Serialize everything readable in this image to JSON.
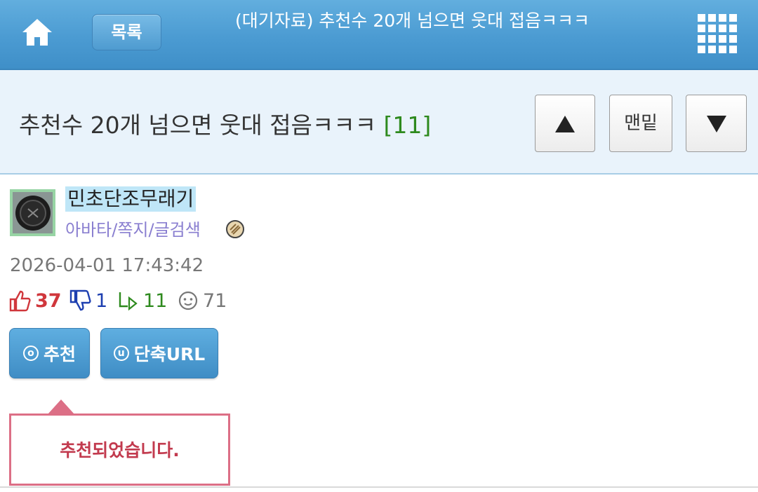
{
  "header": {
    "home_icon": "home-icon",
    "list_label": "목록",
    "title": "(대기자료) 추천수 20개 넘으면 웃대 접음ㅋㅋㅋ",
    "menu_icon": "grid-menu-icon"
  },
  "post": {
    "title": "추천수 20개 넘으면 웃대 접음ㅋㅋㅋ",
    "comment_count": "[11]",
    "nav": {
      "up_icon": "triangle-up-icon",
      "bottom_label": "맨밑",
      "down_icon": "triangle-down-icon"
    }
  },
  "author": {
    "name": "민초단조무래기",
    "links": "아바타/쪽지/글검색",
    "level_icon": "level-badge-icon"
  },
  "meta": {
    "date": "2026-04-01 17:43:42"
  },
  "stats": {
    "recommend": "37",
    "unrecommend": "1",
    "replies": "11",
    "views": "71"
  },
  "actions": {
    "recommend_icon_char": "o",
    "recommend_label": "추천",
    "shorturl_icon_char": "u",
    "shorturl_label": "단축URL"
  },
  "message": {
    "text": "추천되었습니다."
  },
  "colors": {
    "header_blue": "#4b9bd2",
    "title_bar_bg": "#e9f3fb",
    "comment_count_green": "#2e8a1e",
    "recommend_red": "#d0373c",
    "unrecommend_blue": "#1d3fb0",
    "tooltip_border": "#dc6f86"
  }
}
